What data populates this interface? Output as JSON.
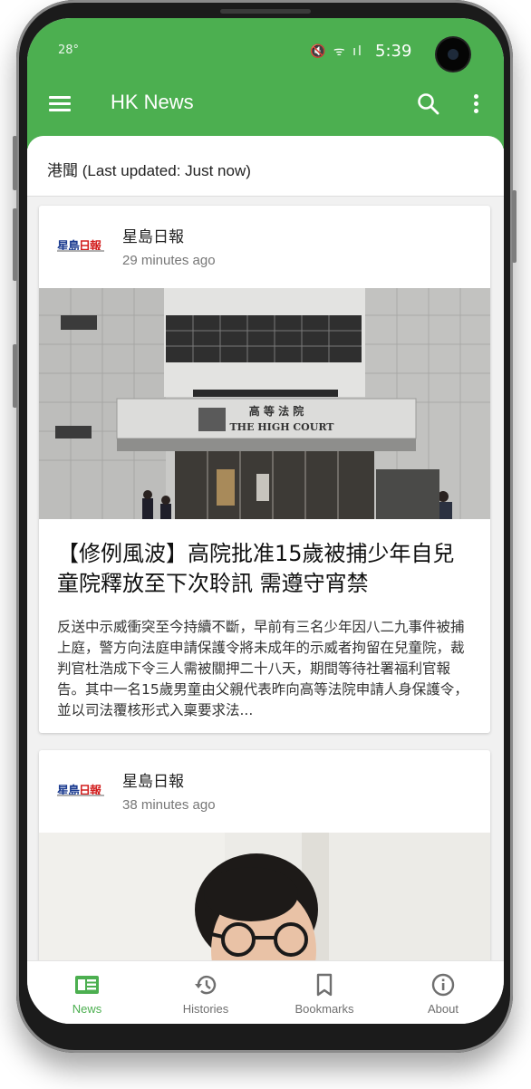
{
  "status_bar": {
    "temperature": "28°",
    "signal_icons": "🔇 ᯤ ıl",
    "time": "5:39"
  },
  "app_bar": {
    "title": "HK News",
    "menu_icon": "hamburger-menu-icon",
    "search_icon": "search-icon",
    "more_icon": "more-vert-icon"
  },
  "section": {
    "title": "港聞 (Last updated: Just now)"
  },
  "cards": [
    {
      "source_logo_text_blue": "星島",
      "source_logo_text_red": "日報",
      "source": "星島日報",
      "time_ago": "29 minutes ago",
      "image_caption_cn": "高 等 法 院",
      "image_caption_en": "THE HIGH COURT",
      "headline": "【修例風波】高院批准15歲被捕少年自兒童院釋放至下次聆訊 需遵守宵禁",
      "summary": "反送中示威衝突至今持續不斷，早前有三名少年因八二九事件被捕上庭，警方向法庭申請保護令將未成年的示威者拘留在兒童院，裁判官杜浩成下令三人需被關押二十八天，期間等待社署福利官報告。其中一名15歲男童由父親代表昨向高等法院申請人身保護令，並以司法覆核形式入稟要求法..."
    },
    {
      "source_logo_text_blue": "星島",
      "source_logo_text_red": "日報",
      "source": "星島日報",
      "time_ago": "38 minutes ago"
    }
  ],
  "bottom_nav": [
    {
      "label": "News",
      "icon": "news-icon",
      "active": true
    },
    {
      "label": "Histories",
      "icon": "history-icon",
      "active": false
    },
    {
      "label": "Bookmarks",
      "icon": "bookmark-icon",
      "active": false
    },
    {
      "label": "About",
      "icon": "info-icon",
      "active": false
    }
  ],
  "colors": {
    "accent": "#4caf50",
    "logo_blue": "#1a3a8f",
    "logo_red": "#d21e1e"
  }
}
